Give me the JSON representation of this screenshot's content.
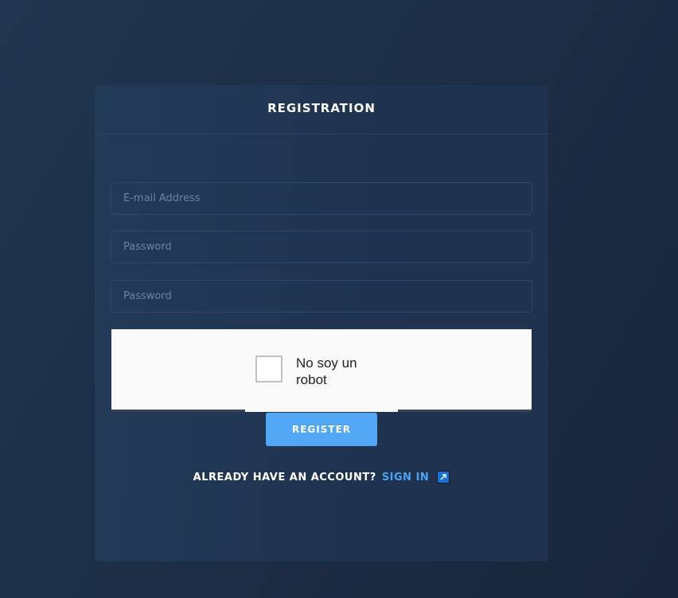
{
  "card": {
    "title": "REGISTRATION"
  },
  "form": {
    "email_placeholder": "E-mail Address",
    "password_placeholder": "Password",
    "confirm_password_placeholder": "Password"
  },
  "captcha": {
    "label": "No soy un robot",
    "checked": false
  },
  "register_button": {
    "label": "REGISTER"
  },
  "signin": {
    "prompt": "ALREADY HAVE AN ACCOUNT?",
    "link_label": "SIGN IN",
    "icon": "external-link-icon"
  },
  "colors": {
    "accent": "#52a7f4",
    "link": "#4aa3f2",
    "card_background": "#213856",
    "page_background": "#1c2c44"
  }
}
